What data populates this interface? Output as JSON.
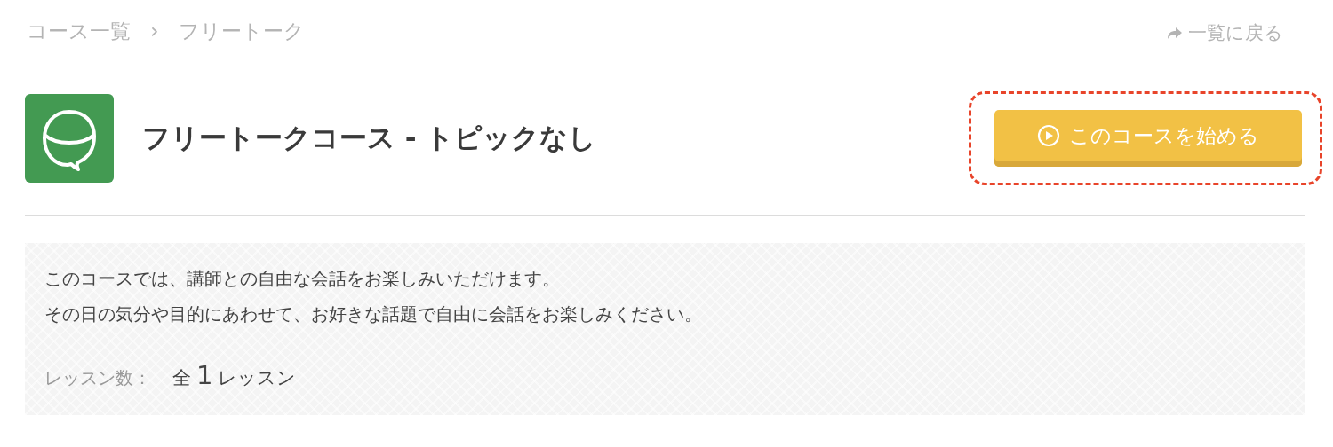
{
  "breadcrumb": {
    "items": [
      "コース一覧",
      "フリートーク"
    ],
    "separator": "›"
  },
  "back_link": {
    "label": "一覧に戻る"
  },
  "course": {
    "title": "フリートークコース - トピックなし"
  },
  "start_button": {
    "label": "このコースを始める",
    "highlighted": true
  },
  "description": {
    "lines": [
      "このコースでは、講師との自由な会話をお楽しみいただけます。",
      "その日の気分や目的にあわせて、お好きな話題で自由に会話をお楽しみください。"
    ]
  },
  "lessons": {
    "label": "レッスン数：",
    "prefix": "全",
    "count": "1",
    "suffix": "レッスン"
  }
}
